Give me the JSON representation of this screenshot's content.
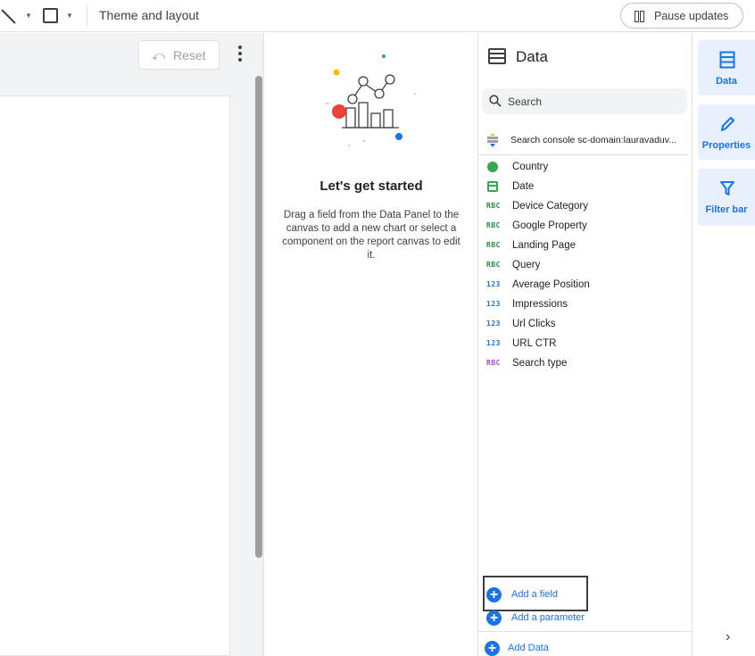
{
  "toolbar": {
    "line_icon": "line-tool-icon",
    "shape_icon": "rectangle-tool-icon",
    "theme_label": "Theme and layout",
    "pause_label": "Pause updates"
  },
  "canvas": {
    "reset_label": "Reset"
  },
  "empty_state": {
    "heading": "Let's get started",
    "description": "Drag a field from the Data Panel to the canvas to add a new chart or select a component on the report canvas to edit it."
  },
  "data_panel": {
    "title": "Data",
    "search_placeholder": "Search",
    "source_name": "Search console sc-domain:lauravaduv...",
    "fields": [
      {
        "name": "Country",
        "type": "geo"
      },
      {
        "name": "Date",
        "type": "date"
      },
      {
        "name": "Device Category",
        "type": "text",
        "tag": "RBC"
      },
      {
        "name": "Google Property",
        "type": "text",
        "tag": "RBC"
      },
      {
        "name": "Landing Page",
        "type": "text",
        "tag": "RBC"
      },
      {
        "name": "Query",
        "type": "text",
        "tag": "RBC"
      },
      {
        "name": "Average Position",
        "type": "number",
        "tag": "123"
      },
      {
        "name": "Impressions",
        "type": "number",
        "tag": "123"
      },
      {
        "name": "Url Clicks",
        "type": "number",
        "tag": "123"
      },
      {
        "name": "URL CTR",
        "type": "number",
        "tag": "123"
      },
      {
        "name": "Search type",
        "type": "calc",
        "tag": "RBC"
      }
    ],
    "add_field": "Add a field",
    "add_parameter": "Add a parameter",
    "add_data": "Add Data"
  },
  "rail": {
    "data": "Data",
    "properties": "Properties",
    "filter_bar": "Filter bar"
  },
  "colors": {
    "accent": "#1a73e8",
    "dimension": "#1e8e3e",
    "metric": "#1a73e8",
    "calculated": "#a142f4"
  }
}
